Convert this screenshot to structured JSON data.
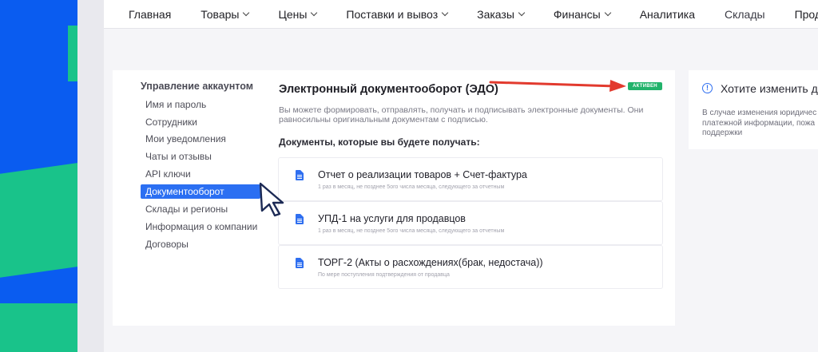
{
  "nav": {
    "items": [
      {
        "label": "Главная",
        "dropdown": false
      },
      {
        "label": "Товары",
        "dropdown": true
      },
      {
        "label": "Цены",
        "dropdown": true
      },
      {
        "label": "Поставки и вывоз",
        "dropdown": true
      },
      {
        "label": "Заказы",
        "dropdown": true
      },
      {
        "label": "Финансы",
        "dropdown": true
      },
      {
        "label": "Аналитика",
        "dropdown": false
      },
      {
        "label": "Склады",
        "dropdown": false
      },
      {
        "label": "Прод",
        "dropdown": false
      }
    ]
  },
  "sidebar": {
    "title": "Управление аккаунтом",
    "items": [
      {
        "label": "Имя и пароль"
      },
      {
        "label": "Сотрудники"
      },
      {
        "label": "Мои уведомления"
      },
      {
        "label": "Чаты и отзывы"
      },
      {
        "label": "API ключи"
      },
      {
        "label": "Документооборот",
        "active": true
      },
      {
        "label": "Склады и регионы"
      },
      {
        "label": "Информация о компании"
      },
      {
        "label": "Договоры"
      }
    ]
  },
  "edo": {
    "title": "Электронный документооборот (ЭДО)",
    "badge": "АКТИВЕН",
    "description": "Вы можете формировать, отправлять, получать и подписывать электронные документы. Они равносильны оригинальным документам с подписью.",
    "docs_title": "Документы, которые вы будете получать:",
    "documents": [
      {
        "name": "Отчет о реализации товаров + Счет-фактура",
        "schedule": "1 раз в месяц, не позднее 5ого числа месяца, следующего за отчетным"
      },
      {
        "name": "УПД-1 на услуги для продавцов",
        "schedule": "1 раз в месяц, не позднее 5ого числа месяца, следующего за отчетным"
      },
      {
        "name": "ТОРГ-2 (Акты о расхождениях(брак, недостача))",
        "schedule": "По мере поступления подтверждения от продавца"
      }
    ]
  },
  "info": {
    "icon": "info-icon",
    "icon_glyph": "!",
    "title": "Хотите изменить д",
    "text": "В случае изменения юридичес платежной информации, пожа поддержки"
  },
  "colors": {
    "accent": "#2b6ff2",
    "badge_green": "#22b36b",
    "annotation_red": "#e23a2e",
    "backdrop_blue": "#0a5cf0",
    "backdrop_green": "#19c38a"
  },
  "annotations": {
    "arrow": "red-arrow-icon",
    "cursor": "mouse-cursor-icon"
  }
}
